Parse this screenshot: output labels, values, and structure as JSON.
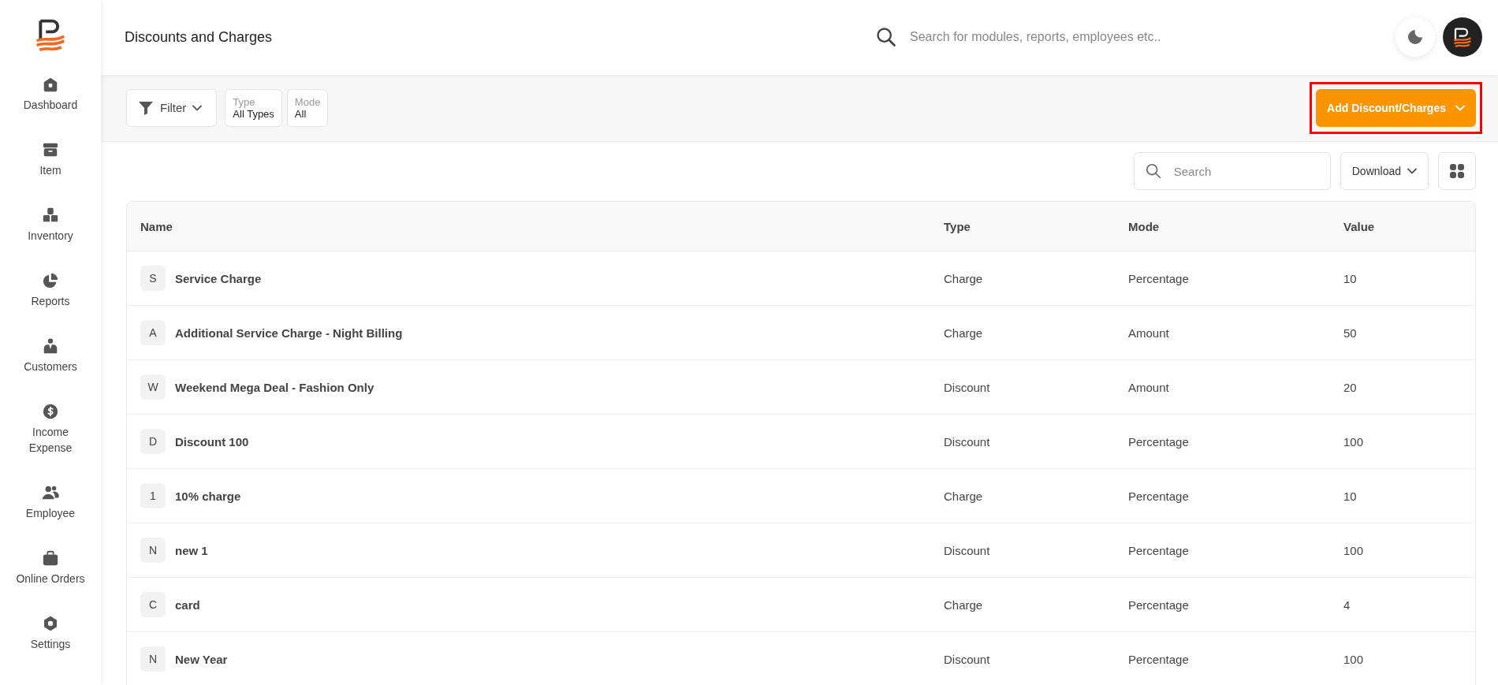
{
  "sidebar": {
    "items": [
      {
        "label": "Dashboard"
      },
      {
        "label": "Item"
      },
      {
        "label": "Inventory"
      },
      {
        "label": "Reports"
      },
      {
        "label": "Customers"
      },
      {
        "label": "Income Expense"
      },
      {
        "label": "Employee"
      },
      {
        "label": "Online Orders"
      },
      {
        "label": "Settings"
      }
    ]
  },
  "header": {
    "title": "Discounts and Charges",
    "search": {
      "placeholder": "Search for modules, reports, employees etc.."
    }
  },
  "filter_bar": {
    "filter_button": "Filter",
    "filters": [
      {
        "label": "Type",
        "value": "All Types"
      },
      {
        "label": "Mode",
        "value": "All"
      }
    ],
    "add_button": {
      "label": "Add Discount/Charges",
      "highlighted": true
    }
  },
  "toolbar": {
    "search": {
      "placeholder": "Search"
    },
    "download_button": "Download"
  },
  "table": {
    "columns": [
      "Name",
      "Type",
      "Mode",
      "Value"
    ],
    "rows": [
      {
        "initial": "S",
        "name": "Service Charge",
        "type": "Charge",
        "mode": "Percentage",
        "value": "10"
      },
      {
        "initial": "A",
        "name": "Additional Service Charge - Night Billing",
        "type": "Charge",
        "mode": "Amount",
        "value": "50"
      },
      {
        "initial": "W",
        "name": "Weekend Mega Deal - Fashion Only",
        "type": "Discount",
        "mode": "Amount",
        "value": "20"
      },
      {
        "initial": "D",
        "name": "Discount 100",
        "type": "Discount",
        "mode": "Percentage",
        "value": "100"
      },
      {
        "initial": "1",
        "name": "10% charge",
        "type": "Charge",
        "mode": "Percentage",
        "value": "10"
      },
      {
        "initial": "N",
        "name": "new 1",
        "type": "Discount",
        "mode": "Percentage",
        "value": "100"
      },
      {
        "initial": "C",
        "name": "card",
        "type": "Charge",
        "mode": "Percentage",
        "value": "4"
      },
      {
        "initial": "N",
        "name": "New Year",
        "type": "Discount",
        "mode": "Percentage",
        "value": "100"
      }
    ]
  }
}
